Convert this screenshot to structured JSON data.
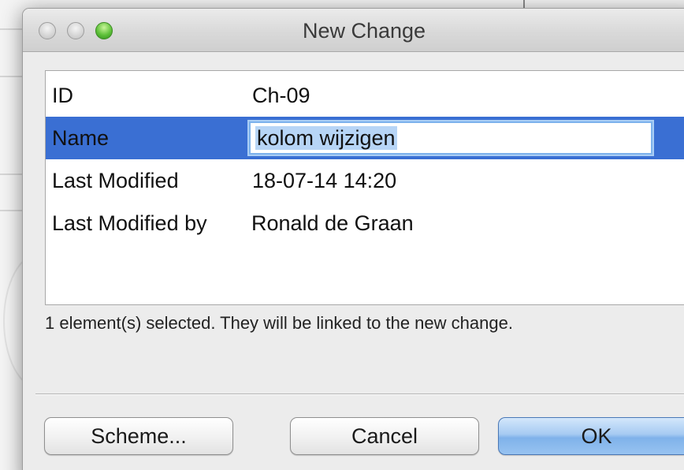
{
  "window": {
    "title": "New Change"
  },
  "properties": [
    {
      "label": "ID",
      "value": "Ch-09"
    },
    {
      "label": "Name",
      "value": "kolom wijzigen"
    },
    {
      "label": "Last Modified",
      "value": "18-07-14 14:20"
    },
    {
      "label": "Last Modified by",
      "value": "Ronald de Graan"
    }
  ],
  "selected_row": "Name",
  "status_text": "1 element(s) selected. They will be linked to the new change.",
  "buttons": {
    "scheme": "Scheme...",
    "cancel": "Cancel",
    "ok": "OK"
  },
  "colors": {
    "selection": "#3a6fd3",
    "default_button": "#8fbdef",
    "maximize_light": "#5fc13a"
  }
}
